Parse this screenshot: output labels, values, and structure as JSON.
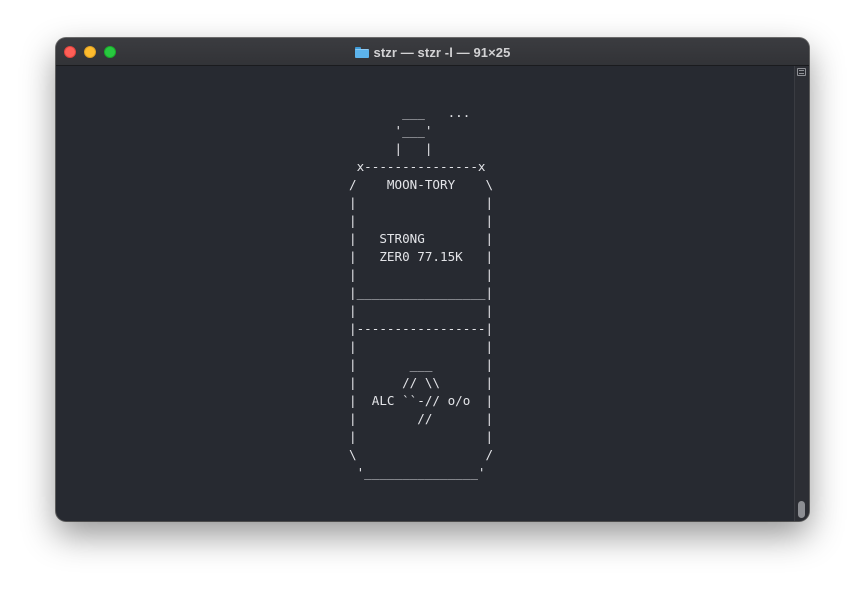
{
  "window": {
    "title": "stzr — stzr -l — 91×25"
  },
  "terminal": {
    "lines": [
      "       ___   ...",
      "      '___'",
      "      |   |",
      " x---------------x",
      "/    MOON-TORY    \\",
      "|                 |",
      "|                 |",
      "|   STR0NG        |",
      "|   ZER0 77.15K   |",
      "|                 |",
      "|_________________|",
      "|                 |",
      "|-----------------|",
      "|                 |",
      "|       ___       |",
      "|      // \\\\      |",
      "|  ALC ``-// o/o  |",
      "|        //       |",
      "|                 |",
      "\\                 /",
      " '_______________'"
    ]
  },
  "colors": {
    "terminal_bg": "#272a31",
    "terminal_fg": "#e3e4e8",
    "titlebar_bg": "#37383c",
    "close": "#fe5f57",
    "minimize": "#febc2e",
    "maximize": "#28c840"
  }
}
